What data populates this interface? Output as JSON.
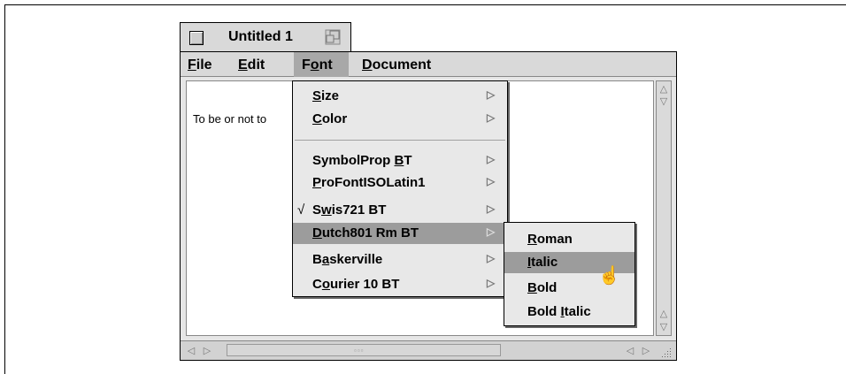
{
  "window": {
    "title": "Untitled 1",
    "document_text": "To be or not to"
  },
  "menubar": [
    {
      "label": "File",
      "ul": "F",
      "rest": "ile"
    },
    {
      "label": "Edit",
      "ul": "E",
      "rest": "dit"
    },
    {
      "label": "Font",
      "pre": "F",
      "ul": "o",
      "rest": "nt"
    },
    {
      "label": "Document",
      "ul": "D",
      "rest": "ocument"
    }
  ],
  "font_menu": {
    "items": [
      {
        "label": "Size",
        "ul": "S",
        "rest": "ize",
        "submenu_arrow": "▷"
      },
      {
        "label": "Color",
        "ul": "C",
        "rest": "olor",
        "submenu_arrow": "▷"
      },
      {
        "label": "SymbolProp BT",
        "pre": "SymbolProp ",
        "ul": "B",
        "rest": "T",
        "submenu_arrow": "▷"
      },
      {
        "label": "ProFontISOLatin1",
        "ul": "P",
        "rest": "roFontISOLatin1",
        "submenu_arrow": "▷"
      },
      {
        "label": "Swis721 BT",
        "pre": "S",
        "ul": "w",
        "rest": "is721 BT",
        "checked": "√",
        "submenu_arrow": "▷"
      },
      {
        "label": "Dutch801 Rm BT",
        "ul": "D",
        "rest": "utch801 Rm BT",
        "highlighted": true,
        "submenu_arrow": "▷"
      },
      {
        "label": "Baskerville",
        "pre": "B",
        "ul": "a",
        "rest": "skerville",
        "submenu_arrow": "▷"
      },
      {
        "label": "Courier 10 BT",
        "pre": "C",
        "ul": "o",
        "rest": "urier 10 BT",
        "submenu_arrow": "▷"
      }
    ]
  },
  "style_submenu": {
    "items": [
      {
        "label": "Roman",
        "ul": "R",
        "rest": "oman"
      },
      {
        "label": "Italic",
        "ul": "I",
        "rest": "talic",
        "highlighted": true
      },
      {
        "label": "Bold",
        "ul": "B",
        "rest": "old"
      },
      {
        "label": "Bold Italic",
        "pre": "Bold ",
        "ul": "I",
        "rest": "talic"
      }
    ]
  },
  "scrollbars": {
    "up_arrow": "△",
    "down_arrow": "▽",
    "left_arrow": "◁",
    "right_arrow": "▷",
    "thumb_grip": "▫▫▫"
  },
  "cursor_glyph": "☝"
}
